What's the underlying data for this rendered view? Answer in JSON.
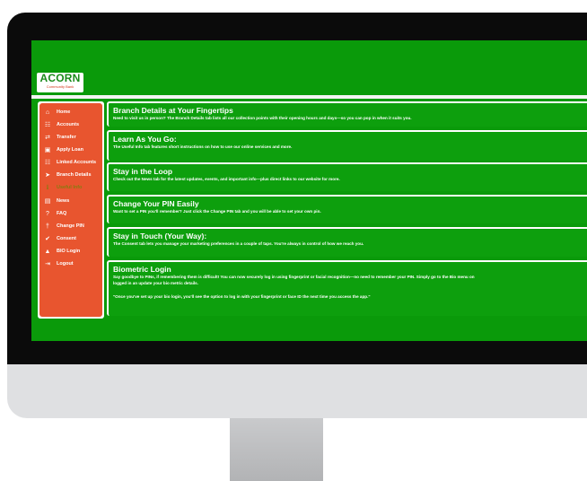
{
  "brand": {
    "name": "ACORN",
    "tagline": "Community Bank"
  },
  "sidebar": {
    "items": [
      {
        "label": "Home",
        "icon": "home-icon",
        "glyph": "⌂"
      },
      {
        "label": "Accounts",
        "icon": "accounts-icon",
        "glyph": "☷"
      },
      {
        "label": "Transfer",
        "icon": "transfer-icon",
        "glyph": "⇄"
      },
      {
        "label": "Apply Loan",
        "icon": "bank-icon",
        "glyph": "▣"
      },
      {
        "label": "Linked Accounts",
        "icon": "linked-accounts-icon",
        "glyph": "☷"
      },
      {
        "label": "Branch Details",
        "icon": "location-arrow-icon",
        "glyph": "➤"
      },
      {
        "label": "Useful Info",
        "icon": "info-icon",
        "glyph": "ℹ",
        "active": true
      },
      {
        "label": "News",
        "icon": "news-icon",
        "glyph": "▤"
      },
      {
        "label": "FAQ",
        "icon": "question-icon",
        "glyph": "?"
      },
      {
        "label": "Change PIN",
        "icon": "key-icon",
        "glyph": "†"
      },
      {
        "label": "Consent",
        "icon": "check-circle-icon",
        "glyph": "✔"
      },
      {
        "label": "BIO Login",
        "icon": "lock-icon",
        "glyph": "▲"
      },
      {
        "label": "Logout",
        "icon": "logout-icon",
        "glyph": "⇥"
      }
    ]
  },
  "cards": [
    {
      "title": "Branch Details at Your Fingertips",
      "body": "Need to visit us in person? The Branch Details tab lists all our collection points with their opening hours and days—so you can pop in when it suits you."
    },
    {
      "title": "Learn As You Go:",
      "body": "The Useful Info tab features short instructions on how to use our online services and more."
    },
    {
      "title": "Stay in the Loop",
      "body": "Check out the News tab for the latest updates, events, and important info—plus direct links to our website for more."
    },
    {
      "title": "Change Your PIN Easily",
      "body": "Want to set a PIN you'll remember? Just click the Change PIN tab and you will be able to set your own pin."
    },
    {
      "title": "Stay in Touch (Your Way):",
      "body": "The Consent tab lets you manage your marketing preferences in a couple of taps. You're always in control of how we reach you."
    },
    {
      "title": "Biometric Login",
      "body": "Say goodbye to PINs, if remembering them is difficult! You can now securely log in using fingerprint or facial recognition—no need to remember your PIN. Simply go to the Bio menu on",
      "body2": "logged in an update your bio metric details.",
      "quote": "\"Once you've set up your bio login, you'll see the option to log in with your fingerprint or face ID the next time you access the app.\""
    }
  ]
}
